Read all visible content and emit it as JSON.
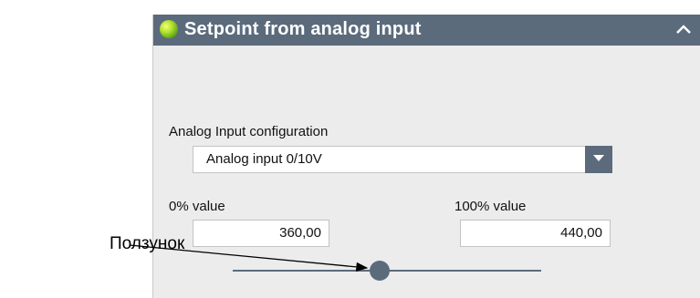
{
  "panel": {
    "title": "Setpoint from analog input",
    "status_color": "#7ac143",
    "header_color": "#5b6b7c",
    "collapse_icon": "chevron-up-icon"
  },
  "analog_config": {
    "label": "Analog Input configuration",
    "selected": "Analog input 0/10V",
    "dropdown_icon": "chevron-down-icon"
  },
  "range": {
    "min_label": "0% value",
    "min_value": "360,00",
    "max_label": "100% value",
    "max_value": "440,00"
  },
  "slider": {
    "position_fraction": 0.45
  },
  "annotation": {
    "label": "Ползунок"
  }
}
